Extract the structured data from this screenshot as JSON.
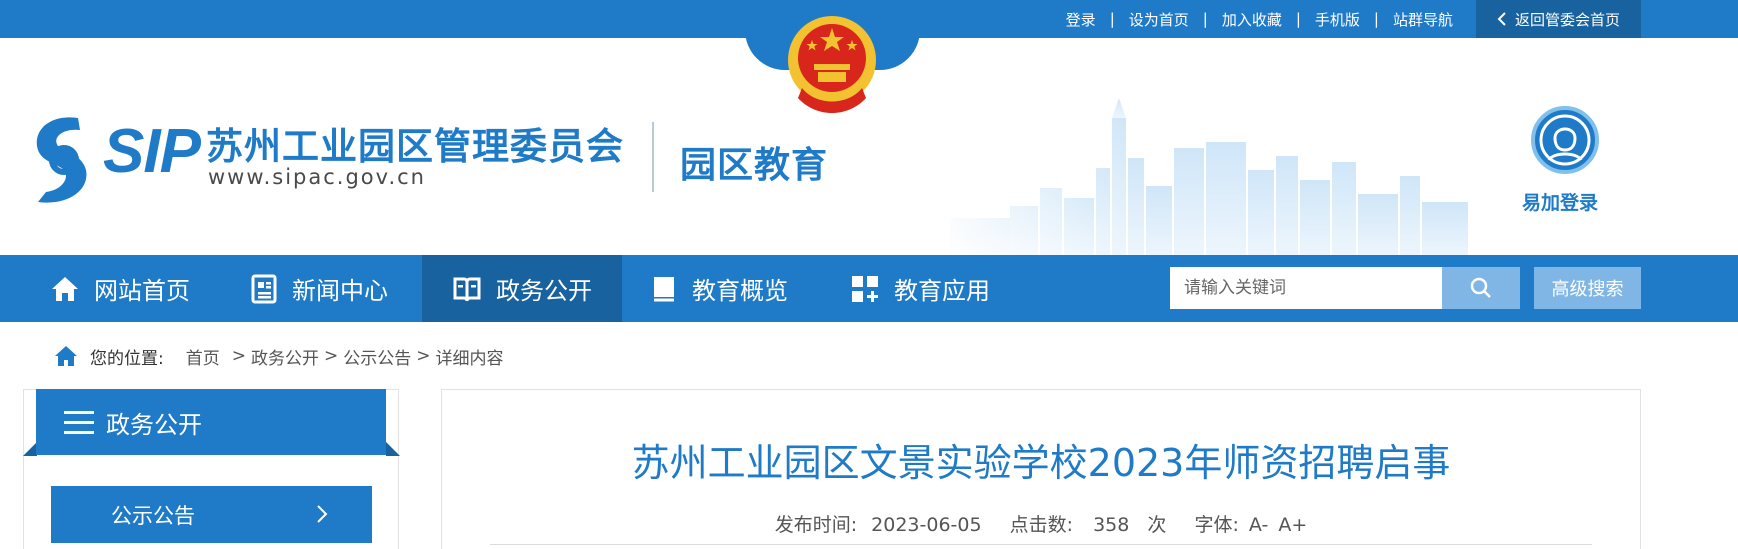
{
  "topbar": {
    "links": [
      "登录",
      "设为首页",
      "加入收藏",
      "手机版",
      "站群导航"
    ],
    "separator": "|",
    "back_label": "返回管委会首页"
  },
  "header": {
    "logo_text": "SIP",
    "org_name": "苏州工业园区管理委员会",
    "org_url": "www.sipac.gov.cn",
    "site_name": "园区教育",
    "login_label": "易加登录"
  },
  "nav": {
    "items": [
      {
        "label": "网站首页",
        "icon": "home-icon"
      },
      {
        "label": "新闻中心",
        "icon": "news-icon"
      },
      {
        "label": "政务公开",
        "icon": "book-icon"
      },
      {
        "label": "教育概览",
        "icon": "notebook-icon"
      },
      {
        "label": "教育应用",
        "icon": "apps-icon"
      }
    ],
    "active_index": 2,
    "search_placeholder": "请输入关键词",
    "advanced_search_label": "高级搜索"
  },
  "breadcrumb": {
    "prefix": "您的位置:",
    "items": [
      "首页",
      "政务公开",
      "公示公告",
      "详细内容"
    ],
    "separator": ">"
  },
  "sidebar": {
    "title": "政务公开",
    "items": [
      "公示公告"
    ]
  },
  "article": {
    "title": "苏州工业园区文景实验学校2023年师资招聘启事",
    "date_label": "发布时间:",
    "date": "2023-06-05",
    "views_label": "点击数:",
    "views": "358",
    "views_unit": "次",
    "font_label": "字体:",
    "font_smaller": "A-",
    "font_larger": "A+"
  },
  "colors": {
    "primary": "#1f7ac7",
    "primary_dark": "#17629f",
    "search_button": "#7fb6e6",
    "emblem_red": "#d8261c",
    "emblem_gold": "#f2c231"
  }
}
